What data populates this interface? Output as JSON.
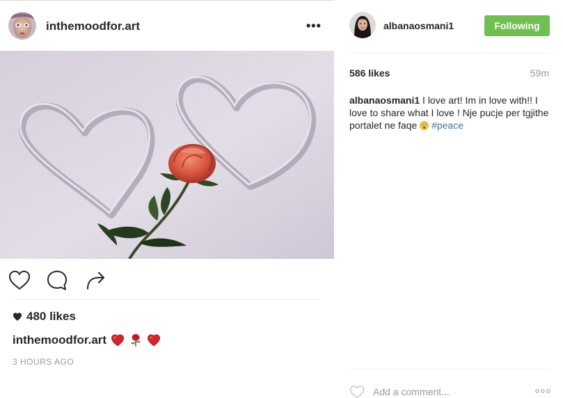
{
  "left_post": {
    "username": "inthemoodfor.art",
    "more_label": "•••",
    "likes": "480 likes",
    "caption_user": "inthemoodfor.art",
    "caption_emojis": [
      "red-heart-emoji",
      "rose-emoji",
      "red-heart-emoji"
    ],
    "timestamp": "3 HOURS AGO",
    "image_alt": "Two hearts drawn in snow with a red rose"
  },
  "right_panel": {
    "username": "albanaosmani1",
    "follow_label": "Following",
    "likes": "586 likes",
    "time": "59m",
    "caption": {
      "user": "albanaosmani1",
      "text": " I love art! Im in love with!! I love to share what I love ! Nje pucje per tgjithe portalet ne faqe ",
      "hashtag": "#peace"
    },
    "comment_placeholder": "Add a comment..."
  },
  "colors": {
    "follow_green": "#70c050",
    "hashtag_blue": "#3f729b",
    "muted_gray": "#999999",
    "text_dark": "#262626"
  },
  "icons": [
    "heart-outline-icon",
    "comment-bubble-icon",
    "share-arrow-icon",
    "heart-filled-icon",
    "more-options-icon"
  ]
}
